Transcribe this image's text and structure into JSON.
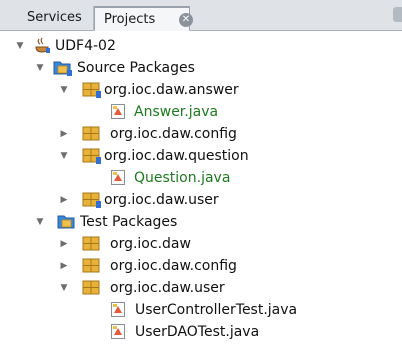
{
  "tabs": {
    "services": "Services",
    "projects": "Projects"
  },
  "tree": {
    "project": "UDF4-02",
    "source_packages": {
      "label": "Source Packages",
      "packages": [
        {
          "label": "org.ioc.daw.answer",
          "files": [
            "Answer.java"
          ]
        },
        {
          "label": "org.ioc.daw.config"
        },
        {
          "label": "org.ioc.daw.question",
          "files": [
            "Question.java"
          ]
        },
        {
          "label": "org.ioc.daw.user"
        }
      ]
    },
    "test_packages": {
      "label": "Test Packages",
      "packages": [
        {
          "label": "org.ioc.daw"
        },
        {
          "label": "org.ioc.daw.config"
        },
        {
          "label": "org.ioc.daw.user",
          "files": [
            "UserControllerTest.java",
            "UserDAOTest.java"
          ]
        }
      ]
    }
  },
  "colors": {
    "file_text": "#1e7a1e",
    "package_icon": "#e8b23a",
    "badge": "#2f6fd6"
  }
}
